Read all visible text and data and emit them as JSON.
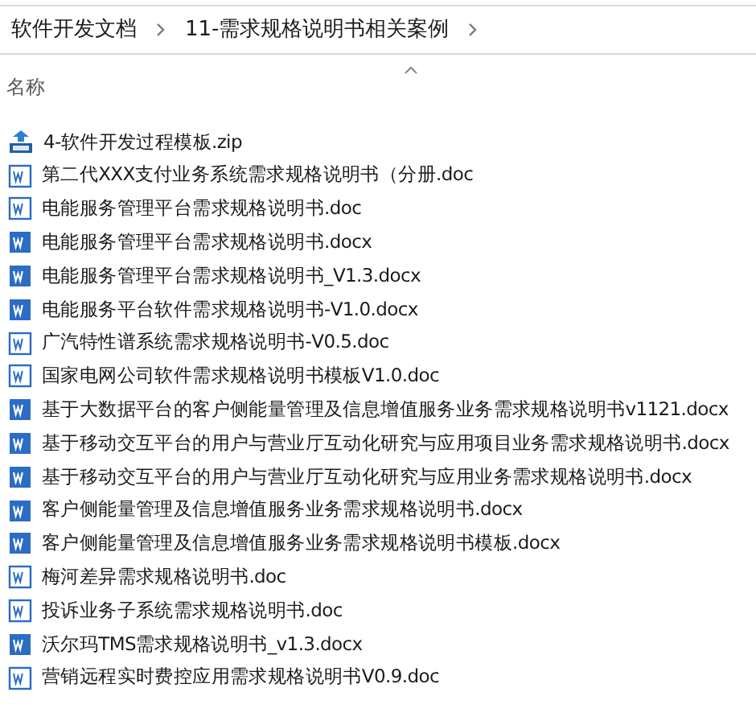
{
  "breadcrumb": [
    "软件开发文档",
    "11-需求规格说明书相关案例"
  ],
  "column_header": {
    "label": "名称"
  },
  "files": [
    {
      "name": "4-软件开发过程模板.zip",
      "kind": "zip"
    },
    {
      "name": "第二代XXX支付业务系统需求规格说明书（分册.doc",
      "kind": "doc"
    },
    {
      "name": "电能服务管理平台需求规格说明书.doc",
      "kind": "doc"
    },
    {
      "name": "电能服务管理平台需求规格说明书.docx",
      "kind": "docx"
    },
    {
      "name": "电能服务管理平台需求规格说明书_V1.3.docx",
      "kind": "docx"
    },
    {
      "name": "电能服务平台软件需求规格说明书-V1.0.docx",
      "kind": "docx"
    },
    {
      "name": "广汽特性谱系统需求规格说明书-V0.5.doc",
      "kind": "doc"
    },
    {
      "name": "国家电网公司软件需求规格说明书模板V1.0.doc",
      "kind": "doc"
    },
    {
      "name": "基于大数据平台的客户侧能量管理及信息增值服务业务需求规格说明书v1121.docx",
      "kind": "docx"
    },
    {
      "name": "基于移动交互平台的用户与营业厅互动化研究与应用项目业务需求规格说明书.docx",
      "kind": "docx"
    },
    {
      "name": "基于移动交互平台的用户与营业厅互动化研究与应用业务需求规格说明书.docx",
      "kind": "docx"
    },
    {
      "name": "客户侧能量管理及信息增值服务业务需求规格说明书.docx",
      "kind": "docx"
    },
    {
      "name": "客户侧能量管理及信息增值服务业务需求规格说明书模板.docx",
      "kind": "docx"
    },
    {
      "name": "梅河差异需求规格说明书.doc",
      "kind": "doc"
    },
    {
      "name": "投诉业务子系统需求规格说明书.doc",
      "kind": "doc"
    },
    {
      "name": "沃尔玛TMS需求规格说明书_v1.3.docx",
      "kind": "docx"
    },
    {
      "name": "营销远程实时费控应用需求规格说明书V0.9.doc",
      "kind": "doc"
    }
  ]
}
